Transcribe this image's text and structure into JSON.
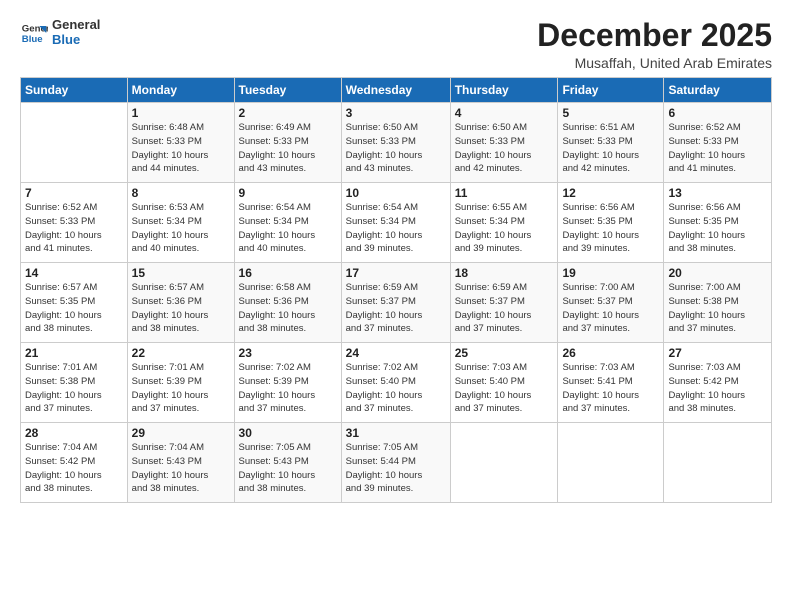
{
  "logo": {
    "line1": "General",
    "line2": "Blue"
  },
  "title": "December 2025",
  "subtitle": "Musaffah, United Arab Emirates",
  "days_header": [
    "Sunday",
    "Monday",
    "Tuesday",
    "Wednesday",
    "Thursday",
    "Friday",
    "Saturday"
  ],
  "weeks": [
    [
      {
        "num": "",
        "info": ""
      },
      {
        "num": "1",
        "info": "Sunrise: 6:48 AM\nSunset: 5:33 PM\nDaylight: 10 hours\nand 44 minutes."
      },
      {
        "num": "2",
        "info": "Sunrise: 6:49 AM\nSunset: 5:33 PM\nDaylight: 10 hours\nand 43 minutes."
      },
      {
        "num": "3",
        "info": "Sunrise: 6:50 AM\nSunset: 5:33 PM\nDaylight: 10 hours\nand 43 minutes."
      },
      {
        "num": "4",
        "info": "Sunrise: 6:50 AM\nSunset: 5:33 PM\nDaylight: 10 hours\nand 42 minutes."
      },
      {
        "num": "5",
        "info": "Sunrise: 6:51 AM\nSunset: 5:33 PM\nDaylight: 10 hours\nand 42 minutes."
      },
      {
        "num": "6",
        "info": "Sunrise: 6:52 AM\nSunset: 5:33 PM\nDaylight: 10 hours\nand 41 minutes."
      }
    ],
    [
      {
        "num": "7",
        "info": "Sunrise: 6:52 AM\nSunset: 5:33 PM\nDaylight: 10 hours\nand 41 minutes."
      },
      {
        "num": "8",
        "info": "Sunrise: 6:53 AM\nSunset: 5:34 PM\nDaylight: 10 hours\nand 40 minutes."
      },
      {
        "num": "9",
        "info": "Sunrise: 6:54 AM\nSunset: 5:34 PM\nDaylight: 10 hours\nand 40 minutes."
      },
      {
        "num": "10",
        "info": "Sunrise: 6:54 AM\nSunset: 5:34 PM\nDaylight: 10 hours\nand 39 minutes."
      },
      {
        "num": "11",
        "info": "Sunrise: 6:55 AM\nSunset: 5:34 PM\nDaylight: 10 hours\nand 39 minutes."
      },
      {
        "num": "12",
        "info": "Sunrise: 6:56 AM\nSunset: 5:35 PM\nDaylight: 10 hours\nand 39 minutes."
      },
      {
        "num": "13",
        "info": "Sunrise: 6:56 AM\nSunset: 5:35 PM\nDaylight: 10 hours\nand 38 minutes."
      }
    ],
    [
      {
        "num": "14",
        "info": "Sunrise: 6:57 AM\nSunset: 5:35 PM\nDaylight: 10 hours\nand 38 minutes."
      },
      {
        "num": "15",
        "info": "Sunrise: 6:57 AM\nSunset: 5:36 PM\nDaylight: 10 hours\nand 38 minutes."
      },
      {
        "num": "16",
        "info": "Sunrise: 6:58 AM\nSunset: 5:36 PM\nDaylight: 10 hours\nand 38 minutes."
      },
      {
        "num": "17",
        "info": "Sunrise: 6:59 AM\nSunset: 5:37 PM\nDaylight: 10 hours\nand 37 minutes."
      },
      {
        "num": "18",
        "info": "Sunrise: 6:59 AM\nSunset: 5:37 PM\nDaylight: 10 hours\nand 37 minutes."
      },
      {
        "num": "19",
        "info": "Sunrise: 7:00 AM\nSunset: 5:37 PM\nDaylight: 10 hours\nand 37 minutes."
      },
      {
        "num": "20",
        "info": "Sunrise: 7:00 AM\nSunset: 5:38 PM\nDaylight: 10 hours\nand 37 minutes."
      }
    ],
    [
      {
        "num": "21",
        "info": "Sunrise: 7:01 AM\nSunset: 5:38 PM\nDaylight: 10 hours\nand 37 minutes."
      },
      {
        "num": "22",
        "info": "Sunrise: 7:01 AM\nSunset: 5:39 PM\nDaylight: 10 hours\nand 37 minutes."
      },
      {
        "num": "23",
        "info": "Sunrise: 7:02 AM\nSunset: 5:39 PM\nDaylight: 10 hours\nand 37 minutes."
      },
      {
        "num": "24",
        "info": "Sunrise: 7:02 AM\nSunset: 5:40 PM\nDaylight: 10 hours\nand 37 minutes."
      },
      {
        "num": "25",
        "info": "Sunrise: 7:03 AM\nSunset: 5:40 PM\nDaylight: 10 hours\nand 37 minutes."
      },
      {
        "num": "26",
        "info": "Sunrise: 7:03 AM\nSunset: 5:41 PM\nDaylight: 10 hours\nand 37 minutes."
      },
      {
        "num": "27",
        "info": "Sunrise: 7:03 AM\nSunset: 5:42 PM\nDaylight: 10 hours\nand 38 minutes."
      }
    ],
    [
      {
        "num": "28",
        "info": "Sunrise: 7:04 AM\nSunset: 5:42 PM\nDaylight: 10 hours\nand 38 minutes."
      },
      {
        "num": "29",
        "info": "Sunrise: 7:04 AM\nSunset: 5:43 PM\nDaylight: 10 hours\nand 38 minutes."
      },
      {
        "num": "30",
        "info": "Sunrise: 7:05 AM\nSunset: 5:43 PM\nDaylight: 10 hours\nand 38 minutes."
      },
      {
        "num": "31",
        "info": "Sunrise: 7:05 AM\nSunset: 5:44 PM\nDaylight: 10 hours\nand 39 minutes."
      },
      {
        "num": "",
        "info": ""
      },
      {
        "num": "",
        "info": ""
      },
      {
        "num": "",
        "info": ""
      }
    ]
  ]
}
